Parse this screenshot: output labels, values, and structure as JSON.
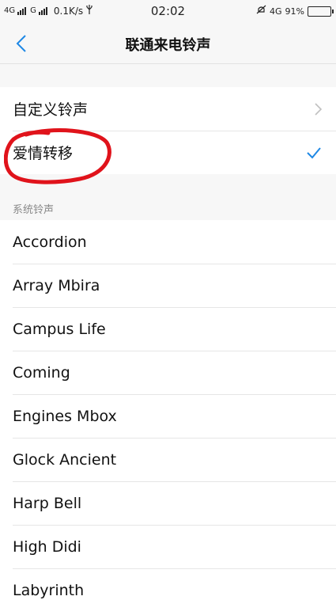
{
  "status_bar": {
    "net1": "4G",
    "net2": "G",
    "speed": "0.1K/s",
    "time": "02:02",
    "net3": "4G",
    "battery": "91%",
    "battery_level": 0.91
  },
  "nav": {
    "title": "联通来电铃声"
  },
  "top_section": [
    {
      "label": "自定义铃声",
      "accessory": "chevron-right-icon"
    },
    {
      "label": "爱情转移",
      "accessory": "checkmark-icon",
      "selected": true
    }
  ],
  "system_section": {
    "header": "系统铃声",
    "items": [
      "Accordion",
      "Array Mbira",
      "Campus Life",
      "Coming",
      "Engines Mbox",
      "Glock Ancient",
      "Harp Bell",
      "High Didi",
      "Labyrinth"
    ]
  },
  "colors": {
    "accent": "#1e88e5",
    "annotation": "#e0131b"
  }
}
